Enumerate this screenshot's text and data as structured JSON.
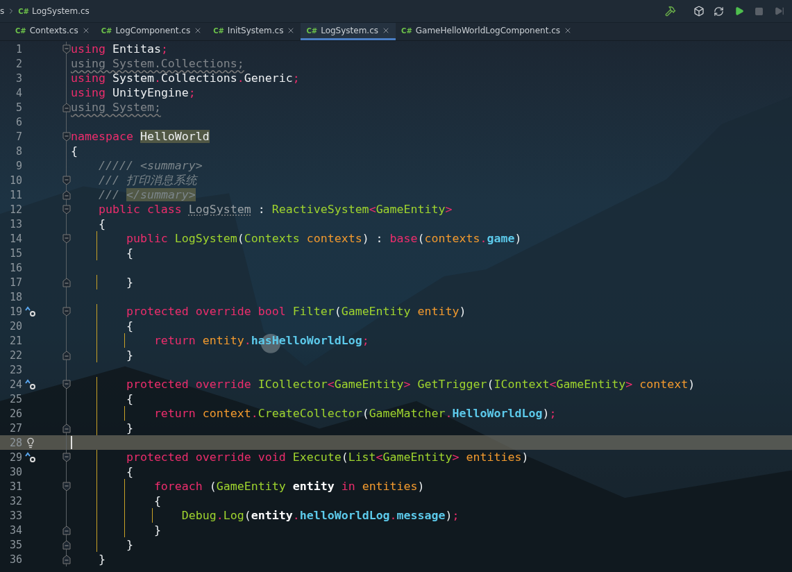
{
  "breadcrumb": {
    "parent": "s",
    "lang": "C#",
    "file": "LogSystem.cs"
  },
  "tabs": [
    {
      "lang": "C#",
      "label": "Contexts.cs",
      "selected": false
    },
    {
      "lang": "C#",
      "label": "LogComponent.cs",
      "selected": false
    },
    {
      "lang": "C#",
      "label": "InitSystem.cs",
      "selected": false
    },
    {
      "lang": "C#",
      "label": "LogSystem.cs",
      "selected": true
    },
    {
      "lang": "C#",
      "label": "GameHelloWorldLogComponent.cs",
      "selected": false
    }
  ],
  "lines": [
    {
      "number": "1",
      "current": false,
      "fold": {
        "kind": "start"
      },
      "tokens": [
        {
          "t": "using",
          "kind": "kw"
        },
        {
          "t": " Entitas",
          "kind": "plain"
        },
        {
          "t": ";",
          "kind": "punct"
        }
      ]
    },
    {
      "number": "2",
      "current": false,
      "tokens": [
        {
          "t": "using System.Collections;",
          "kind": "unused"
        }
      ]
    },
    {
      "number": "3",
      "current": false,
      "tokens": [
        {
          "t": "using",
          "kind": "kw"
        },
        {
          "t": " System",
          "kind": "plain"
        },
        {
          "t": ".",
          "kind": "punct"
        },
        {
          "t": "Collections",
          "kind": "plain"
        },
        {
          "t": ".",
          "kind": "punct"
        },
        {
          "t": "Generic",
          "kind": "plain"
        },
        {
          "t": ";",
          "kind": "punct"
        }
      ]
    },
    {
      "number": "4",
      "current": false,
      "tokens": [
        {
          "t": "using",
          "kind": "kw"
        },
        {
          "t": " UnityEngine",
          "kind": "plain"
        },
        {
          "t": ";",
          "kind": "punct"
        }
      ]
    },
    {
      "number": "5",
      "current": false,
      "fold": {
        "kind": "end"
      },
      "tokens": [
        {
          "t": "using System;",
          "kind": "unused"
        }
      ]
    },
    {
      "number": "6",
      "current": false
    },
    {
      "number": "7",
      "current": false,
      "fold": {
        "kind": "start"
      },
      "tokens": [
        {
          "t": "namespace ",
          "kind": "kw"
        },
        {
          "t": "HelloWorld",
          "kind": "plain",
          "highlight": true
        }
      ]
    },
    {
      "number": "8",
      "current": false,
      "tokens": [
        {
          "t": "{",
          "kind": "plain"
        }
      ]
    },
    {
      "number": "9",
      "current": false,
      "tokens": [
        {
          "t": "    ///// <summary>",
          "kind": "comment"
        }
      ]
    },
    {
      "number": "10",
      "current": false,
      "fold": {
        "kind": "start"
      },
      "tokens": [
        {
          "t": "    /// 打印消息系统",
          "kind": "comment"
        }
      ]
    },
    {
      "number": "11",
      "current": false,
      "fold": {
        "kind": "end"
      },
      "tokens": [
        {
          "t": "    /// ",
          "kind": "comment"
        },
        {
          "t": "</summary>",
          "kind": "comment",
          "highlight": true
        }
      ]
    },
    {
      "number": "12",
      "current": false,
      "fold": {
        "kind": "start"
      },
      "tokens": [
        {
          "t": "    public class ",
          "kind": "kw"
        },
        {
          "t": "LogSystem",
          "kind": "unusedname"
        },
        {
          "t": " : ",
          "kind": "plain"
        },
        {
          "t": "ReactiveSystem",
          "kind": "type"
        },
        {
          "t": "<",
          "kind": "punct"
        },
        {
          "t": "GameEntity",
          "kind": "type"
        },
        {
          "t": ">",
          "kind": "punct"
        }
      ]
    },
    {
      "number": "13",
      "current": false,
      "tokens": [
        {
          "t": "    {",
          "kind": "plain"
        }
      ]
    },
    {
      "number": "14",
      "current": false,
      "fold": {
        "kind": "start"
      },
      "tokens": [
        {
          "t": "        public ",
          "kind": "kw"
        },
        {
          "t": "LogSystem",
          "kind": "type"
        },
        {
          "t": "(",
          "kind": "plain"
        },
        {
          "t": "Contexts ",
          "kind": "type"
        },
        {
          "t": "contexts",
          "kind": "param"
        },
        {
          "t": ") : ",
          "kind": "plain"
        },
        {
          "t": "base",
          "kind": "kw"
        },
        {
          "t": "(",
          "kind": "plain"
        },
        {
          "t": "contexts",
          "kind": "param"
        },
        {
          "t": ".",
          "kind": "punct"
        },
        {
          "t": "game",
          "kind": "field"
        },
        {
          "t": ")",
          "kind": "plain"
        }
      ]
    },
    {
      "number": "15",
      "current": false,
      "tokens": [
        {
          "t": "        {",
          "kind": "plain"
        }
      ]
    },
    {
      "number": "16",
      "current": false
    },
    {
      "number": "17",
      "current": false,
      "fold": {
        "kind": "end"
      },
      "tokens": [
        {
          "t": "        }",
          "kind": "plain"
        }
      ]
    },
    {
      "number": "18",
      "current": false
    },
    {
      "number": "19",
      "current": false,
      "marker": {
        "kind": "override"
      },
      "fold": {
        "kind": "start"
      },
      "tokens": [
        {
          "t": "        protected override bool ",
          "kind": "kw"
        },
        {
          "t": "Filter",
          "kind": "type"
        },
        {
          "t": "(",
          "kind": "plain"
        },
        {
          "t": "GameEntity ",
          "kind": "type"
        },
        {
          "t": "entity",
          "kind": "param"
        },
        {
          "t": ")",
          "kind": "plain"
        }
      ]
    },
    {
      "number": "20",
      "current": false,
      "tokens": [
        {
          "t": "        {",
          "kind": "plain"
        }
      ]
    },
    {
      "number": "21",
      "current": false,
      "tokens": [
        {
          "t": "            return ",
          "kind": "kw"
        },
        {
          "t": "entity",
          "kind": "param"
        },
        {
          "t": ".",
          "kind": "punct"
        },
        {
          "t": "hasHelloWorldLog",
          "kind": "field"
        },
        {
          "t": ";",
          "kind": "punct"
        }
      ]
    },
    {
      "number": "22",
      "current": false,
      "fold": {
        "kind": "end"
      },
      "tokens": [
        {
          "t": "        }",
          "kind": "plain"
        }
      ]
    },
    {
      "number": "23",
      "current": false
    },
    {
      "number": "24",
      "current": false,
      "marker": {
        "kind": "override"
      },
      "fold": {
        "kind": "start"
      },
      "tokens": [
        {
          "t": "        protected override ",
          "kind": "kw"
        },
        {
          "t": "ICollector",
          "kind": "type"
        },
        {
          "t": "<",
          "kind": "punct"
        },
        {
          "t": "GameEntity",
          "kind": "type"
        },
        {
          "t": "> ",
          "kind": "punct"
        },
        {
          "t": "GetTrigger",
          "kind": "type"
        },
        {
          "t": "(",
          "kind": "plain"
        },
        {
          "t": "IContext",
          "kind": "type"
        },
        {
          "t": "<",
          "kind": "punct"
        },
        {
          "t": "GameEntity",
          "kind": "type"
        },
        {
          "t": "> ",
          "kind": "punct"
        },
        {
          "t": "context",
          "kind": "param"
        },
        {
          "t": ")",
          "kind": "plain"
        }
      ]
    },
    {
      "number": "25",
      "current": false,
      "tokens": [
        {
          "t": "        {",
          "kind": "plain"
        }
      ]
    },
    {
      "number": "26",
      "current": false,
      "tokens": [
        {
          "t": "            return ",
          "kind": "kw"
        },
        {
          "t": "context",
          "kind": "param"
        },
        {
          "t": ".",
          "kind": "punct"
        },
        {
          "t": "CreateCollector",
          "kind": "type"
        },
        {
          "t": "(",
          "kind": "plain"
        },
        {
          "t": "GameMatcher",
          "kind": "type"
        },
        {
          "t": ".",
          "kind": "punct"
        },
        {
          "t": "HelloWorldLog",
          "kind": "field"
        },
        {
          "t": ")",
          "kind": "plain"
        },
        {
          "t": ";",
          "kind": "punct"
        }
      ]
    },
    {
      "number": "27",
      "current": false,
      "fold": {
        "kind": "end"
      },
      "tokens": [
        {
          "t": "        }",
          "kind": "plain"
        }
      ]
    },
    {
      "number": "28",
      "current": true,
      "marker": {
        "kind": "bulb"
      }
    },
    {
      "number": "29",
      "current": false,
      "marker": {
        "kind": "override"
      },
      "fold": {
        "kind": "start"
      },
      "tokens": [
        {
          "t": "        protected override void ",
          "kind": "kw"
        },
        {
          "t": "Execute",
          "kind": "type"
        },
        {
          "t": "(",
          "kind": "plain"
        },
        {
          "t": "List",
          "kind": "type"
        },
        {
          "t": "<",
          "kind": "punct"
        },
        {
          "t": "GameEntity",
          "kind": "type"
        },
        {
          "t": "> ",
          "kind": "punct"
        },
        {
          "t": "entities",
          "kind": "param"
        },
        {
          "t": ")",
          "kind": "plain"
        }
      ]
    },
    {
      "number": "30",
      "current": false,
      "tokens": [
        {
          "t": "        {",
          "kind": "plain"
        }
      ]
    },
    {
      "number": "31",
      "current": false,
      "fold": {
        "kind": "start"
      },
      "tokens": [
        {
          "t": "            foreach",
          "kind": "kw"
        },
        {
          "t": " (",
          "kind": "plain"
        },
        {
          "t": "GameEntity ",
          "kind": "type"
        },
        {
          "t": "entity ",
          "kind": "local"
        },
        {
          "t": "in ",
          "kind": "kw"
        },
        {
          "t": "entities",
          "kind": "param"
        },
        {
          "t": ")",
          "kind": "plain"
        }
      ]
    },
    {
      "number": "32",
      "current": false,
      "tokens": [
        {
          "t": "            {",
          "kind": "plain"
        }
      ]
    },
    {
      "number": "33",
      "current": false,
      "tokens": [
        {
          "t": "                Debug",
          "kind": "type"
        },
        {
          "t": ".",
          "kind": "punct"
        },
        {
          "t": "Log",
          "kind": "type"
        },
        {
          "t": "(",
          "kind": "plain"
        },
        {
          "t": "entity",
          "kind": "local"
        },
        {
          "t": ".",
          "kind": "punct"
        },
        {
          "t": "helloWorldLog",
          "kind": "field"
        },
        {
          "t": ".",
          "kind": "punct"
        },
        {
          "t": "message",
          "kind": "field"
        },
        {
          "t": ")",
          "kind": "plain"
        },
        {
          "t": ";",
          "kind": "punct"
        }
      ]
    },
    {
      "number": "34",
      "current": false,
      "fold": {
        "kind": "end"
      },
      "tokens": [
        {
          "t": "            }",
          "kind": "plain"
        }
      ]
    },
    {
      "number": "35",
      "current": false,
      "fold": {
        "kind": "end"
      },
      "tokens": [
        {
          "t": "        }",
          "kind": "plain"
        }
      ]
    },
    {
      "number": "36",
      "current": false,
      "fold": {
        "kind": "end"
      },
      "tokens": [
        {
          "t": "    }",
          "kind": "plain"
        }
      ]
    }
  ]
}
